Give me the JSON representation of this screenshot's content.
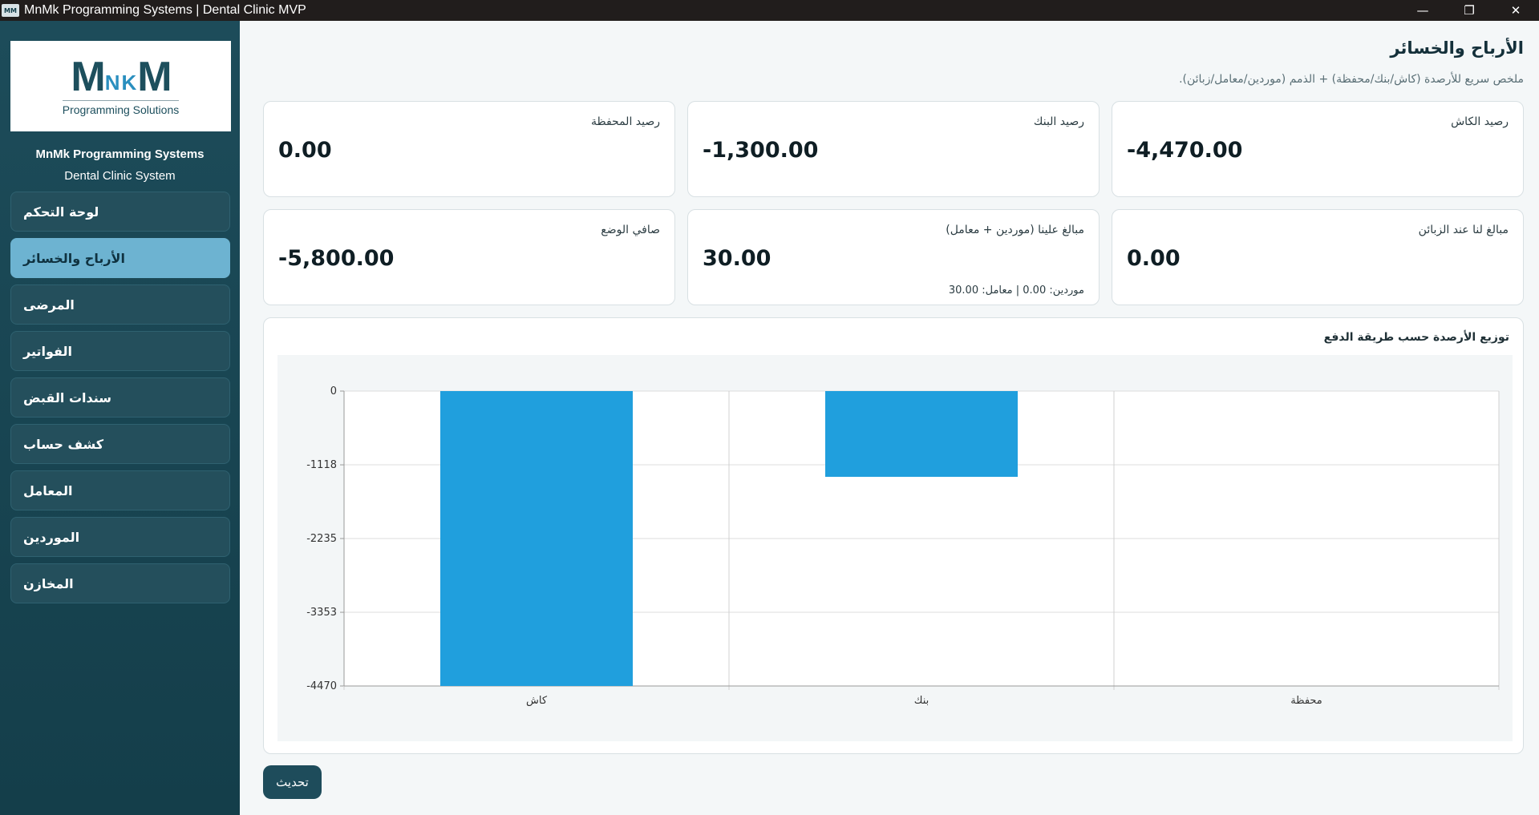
{
  "window": {
    "title": "MnMk Programming Systems | Dental Clinic MVP",
    "icon_text": "MM",
    "minimize_glyph": "—",
    "restore_glyph": "❐",
    "close_glyph": "✕"
  },
  "sidebar": {
    "logo": {
      "mark_left": "M",
      "mark_mid": "N",
      "mark_mid2": "K",
      "mark_right": "M",
      "subtitle": "Programming Solutions"
    },
    "company": "MnMk Programming Systems",
    "system": "Dental Clinic System",
    "items": [
      {
        "label": "لوحة التحكم",
        "active": false
      },
      {
        "label": "الأرباح والخسائر",
        "active": true
      },
      {
        "label": "المرضى",
        "active": false
      },
      {
        "label": "الفواتير",
        "active": false
      },
      {
        "label": "سندات القبض",
        "active": false
      },
      {
        "label": "كشف حساب",
        "active": false
      },
      {
        "label": "المعامل",
        "active": false
      },
      {
        "label": "الموردين",
        "active": false
      },
      {
        "label": "المخازن",
        "active": false
      }
    ]
  },
  "main": {
    "title": "الأرباح والخسائر",
    "subtitle": "ملخص سريع للأرصدة (كاش/بنك/محفظة) + الذمم (موردين/معامل/زبائن).",
    "cards": [
      {
        "label": "رصيد الكاش",
        "value": "-4,470.00",
        "note": ""
      },
      {
        "label": "رصيد البنك",
        "value": "-1,300.00",
        "note": ""
      },
      {
        "label": "رصيد المحفظة",
        "value": "0.00",
        "note": ""
      },
      {
        "label": "مبالغ لنا عند الزبائن",
        "value": "0.00",
        "note": ""
      },
      {
        "label": "مبالغ علينا (موردين + معامل)",
        "value": "30.00",
        "note": "موردين: 0.00 | معامل: 30.00"
      },
      {
        "label": "صافي الوضع",
        "value": "-5,800.00",
        "note": ""
      }
    ],
    "chart_title": "توزيع الأرصدة حسب طريقة الدفع",
    "refresh_label": "تحديث"
  },
  "chart_data": {
    "type": "bar",
    "title": "توزيع الأرصدة حسب طريقة الدفع",
    "categories": [
      "كاش",
      "بنك",
      "محفظة"
    ],
    "values": [
      -4470,
      -1300,
      0
    ],
    "ylim": [
      -4470,
      0
    ],
    "yticks": [
      "0",
      "-1118",
      "-2235",
      "-3353",
      "-4470"
    ],
    "ytick_values": [
      0,
      -1118,
      -2235,
      -3353,
      -4470
    ],
    "bar_color": "#209fdd",
    "grid": true,
    "legend": "none"
  }
}
